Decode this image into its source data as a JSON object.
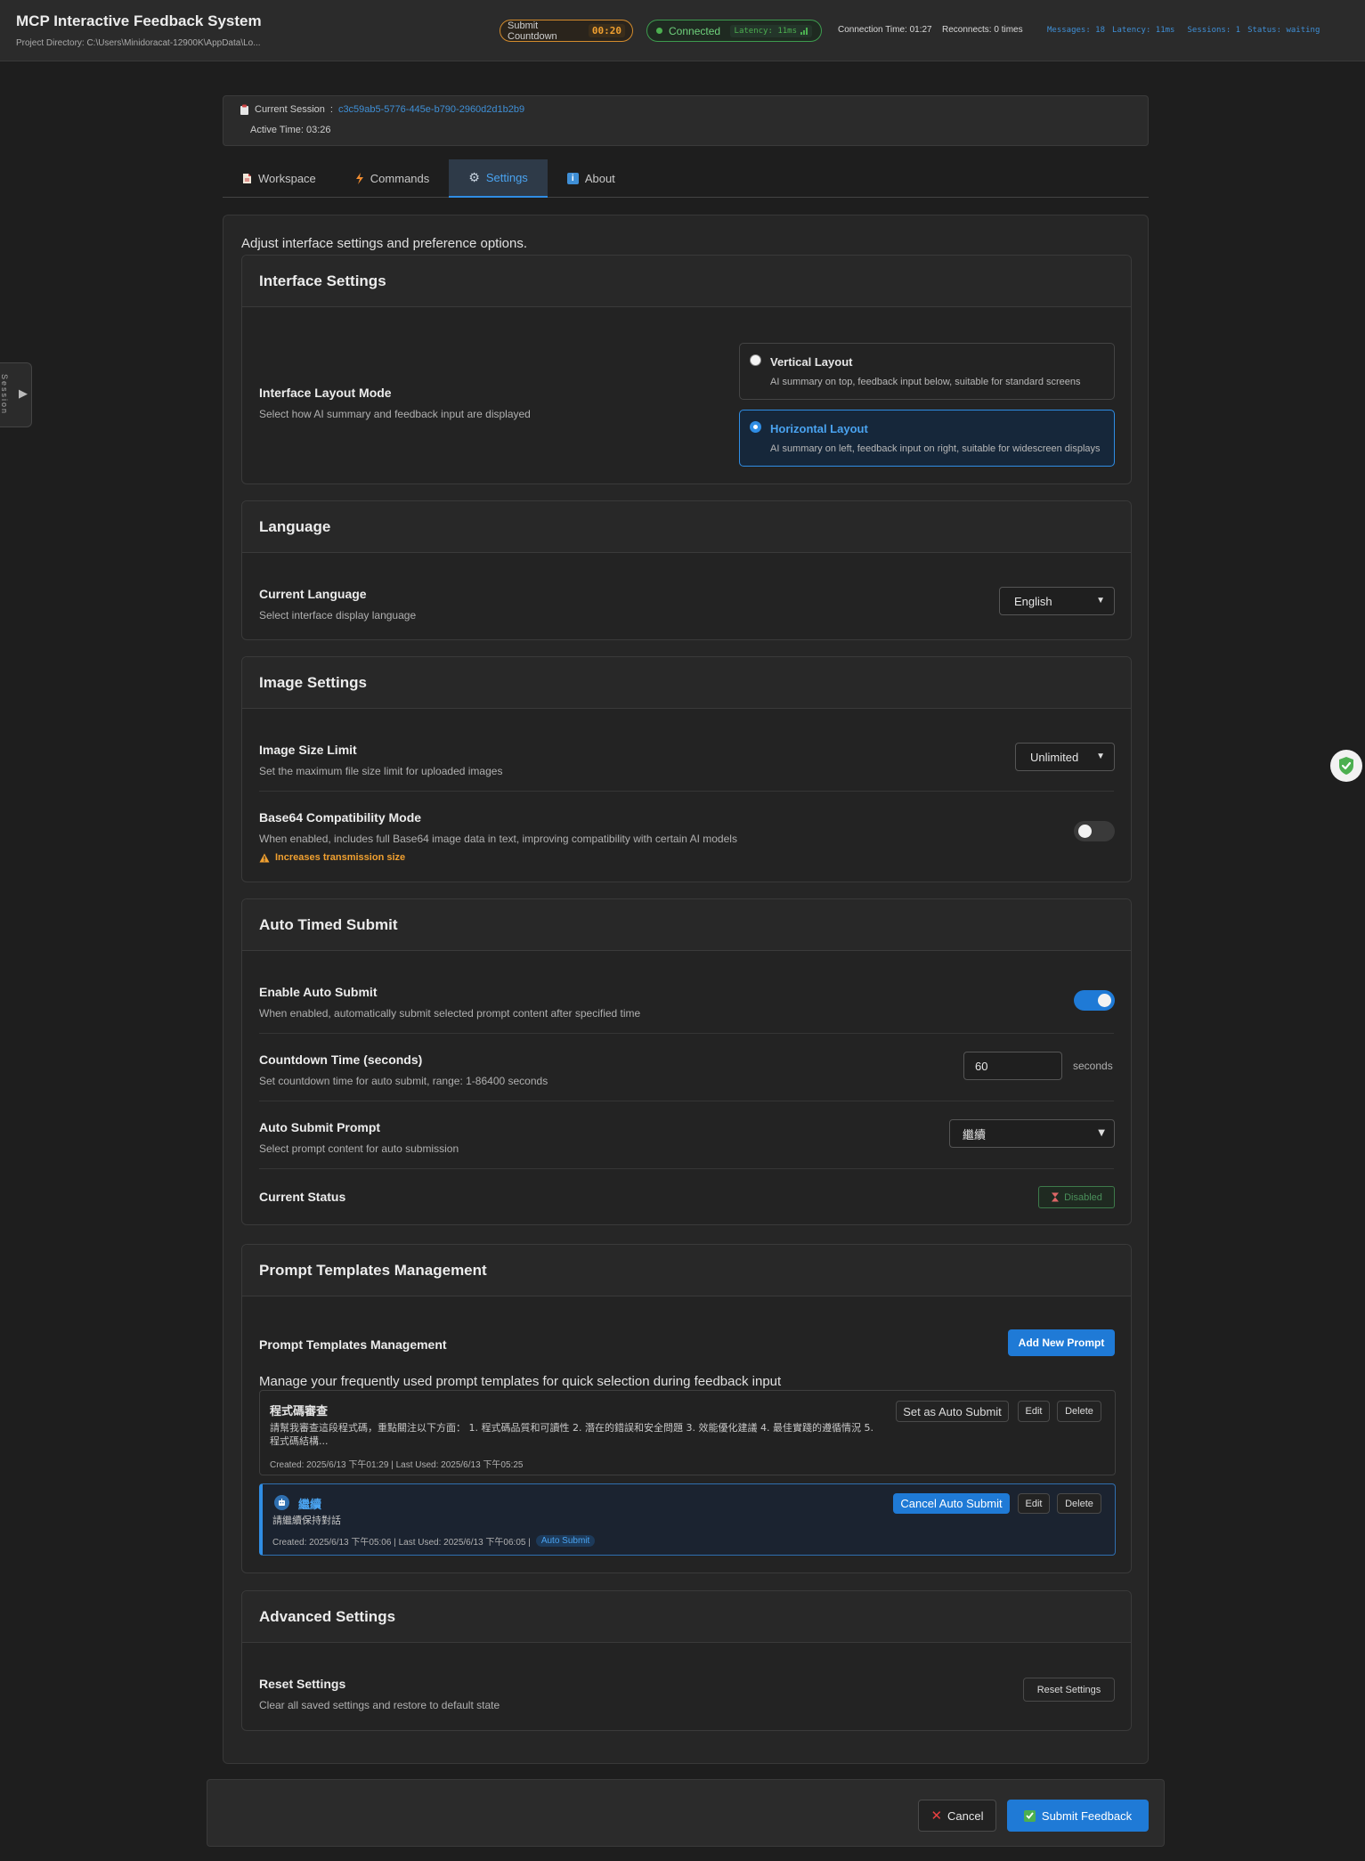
{
  "header": {
    "title": "MCP Interactive Feedback System",
    "project_dir": "Project Directory: C:\\Users\\Minidoracat-12900K\\AppData\\Lo...",
    "countdown_label": "Submit Countdown",
    "countdown_value": "00:20",
    "connection_status": "Connected",
    "latency_badge": "Latency: 11ms",
    "connection_time": "Connection Time: 01:27",
    "reconnects": "Reconnects: 0 times",
    "stats": {
      "messages": "Messages: 18",
      "latency": "Latency: 11ms",
      "sessions": "Sessions: 1",
      "status": "Status: waiting"
    }
  },
  "side_tab": {
    "label": "Session"
  },
  "session": {
    "label": "Current Session",
    "separator": ":",
    "id": "c3c59ab5-5776-445e-b790-2960d2d1b2b9",
    "active_time": "Active Time: 03:26"
  },
  "tabs": [
    {
      "label": "Workspace",
      "icon": "document-icon",
      "active": false
    },
    {
      "label": "Commands",
      "icon": "lightning-icon",
      "active": false
    },
    {
      "label": "Settings",
      "icon": "gear-icon",
      "active": true
    },
    {
      "label": "About",
      "icon": "info-icon",
      "active": false
    }
  ],
  "settings": {
    "intro": "Adjust interface settings and preference options.",
    "interface": {
      "heading": "Interface Settings",
      "layout_title": "Interface Layout Mode",
      "layout_desc": "Select how AI summary and feedback input are displayed",
      "options": [
        {
          "title": "Vertical Layout",
          "desc": "AI summary on top, feedback input below, suitable for standard screens",
          "selected": false
        },
        {
          "title": "Horizontal Layout",
          "desc": "AI summary on left, feedback input on right, suitable for widescreen displays",
          "selected": true
        }
      ]
    },
    "language": {
      "heading": "Language",
      "title": "Current Language",
      "desc": "Select interface display language",
      "selected": "English"
    },
    "image": {
      "heading": "Image Settings",
      "size_title": "Image Size Limit",
      "size_desc": "Set the maximum file size limit for uploaded images",
      "size_value": "Unlimited",
      "base64_title": "Base64 Compatibility Mode",
      "base64_desc": "When enabled, includes full Base64 image data in text, improving compatibility with certain AI models",
      "base64_warning": "Increases transmission size",
      "base64_enabled": false
    },
    "auto_submit": {
      "heading": "Auto Timed Submit",
      "enable_title": "Enable Auto Submit",
      "enable_desc": "When enabled, automatically submit selected prompt content after specified time",
      "enabled": true,
      "countdown_title": "Countdown Time (seconds)",
      "countdown_desc": "Set countdown time for auto submit, range: 1-86400 seconds",
      "countdown_value": "60",
      "countdown_unit": "seconds",
      "prompt_title": "Auto Submit Prompt",
      "prompt_desc": "Select prompt content for auto submission",
      "prompt_value": "繼續",
      "status_title": "Current Status",
      "status_value": "Disabled"
    },
    "templates": {
      "heading": "Prompt Templates Management",
      "sub_title": "Prompt Templates Management",
      "add_button": "Add New Prompt",
      "desc": "Manage your frequently used prompt templates for quick selection during feedback input",
      "items": [
        {
          "name": "程式碼審查",
          "content": "請幫我審查這段程式碼，重點關注以下方面： 1. 程式碼品質和可讀性 2. 潛在的錯誤和安全問題 3. 效能優化建議 4. 最佳實踐的遵循情況 5. 程式碼結構...",
          "meta": "Created: 2025/6/13 下午01:29 | Last Used: 2025/6/13 下午05:25",
          "auto_button": "Set as Auto Submit",
          "edit": "Edit",
          "delete": "Delete"
        },
        {
          "name": "繼續",
          "content": "請繼續保持對話",
          "meta": "Created: 2025/6/13 下午05:06 | Last Used: 2025/6/13 下午06:05 |",
          "tag": "Auto Submit",
          "auto_button": "Cancel Auto Submit",
          "edit": "Edit",
          "delete": "Delete"
        }
      ]
    },
    "advanced": {
      "heading": "Advanced Settings",
      "reset_title": "Reset Settings",
      "reset_desc": "Clear all saved settings and restore to default state",
      "reset_button": "Reset Settings"
    }
  },
  "footer": {
    "cancel": "Cancel",
    "submit": "Submit Feedback"
  },
  "colors": {
    "accent": "#1f7ad6",
    "success": "#4caf50",
    "warning": "#f0a030",
    "background": "#1e1e1e"
  }
}
